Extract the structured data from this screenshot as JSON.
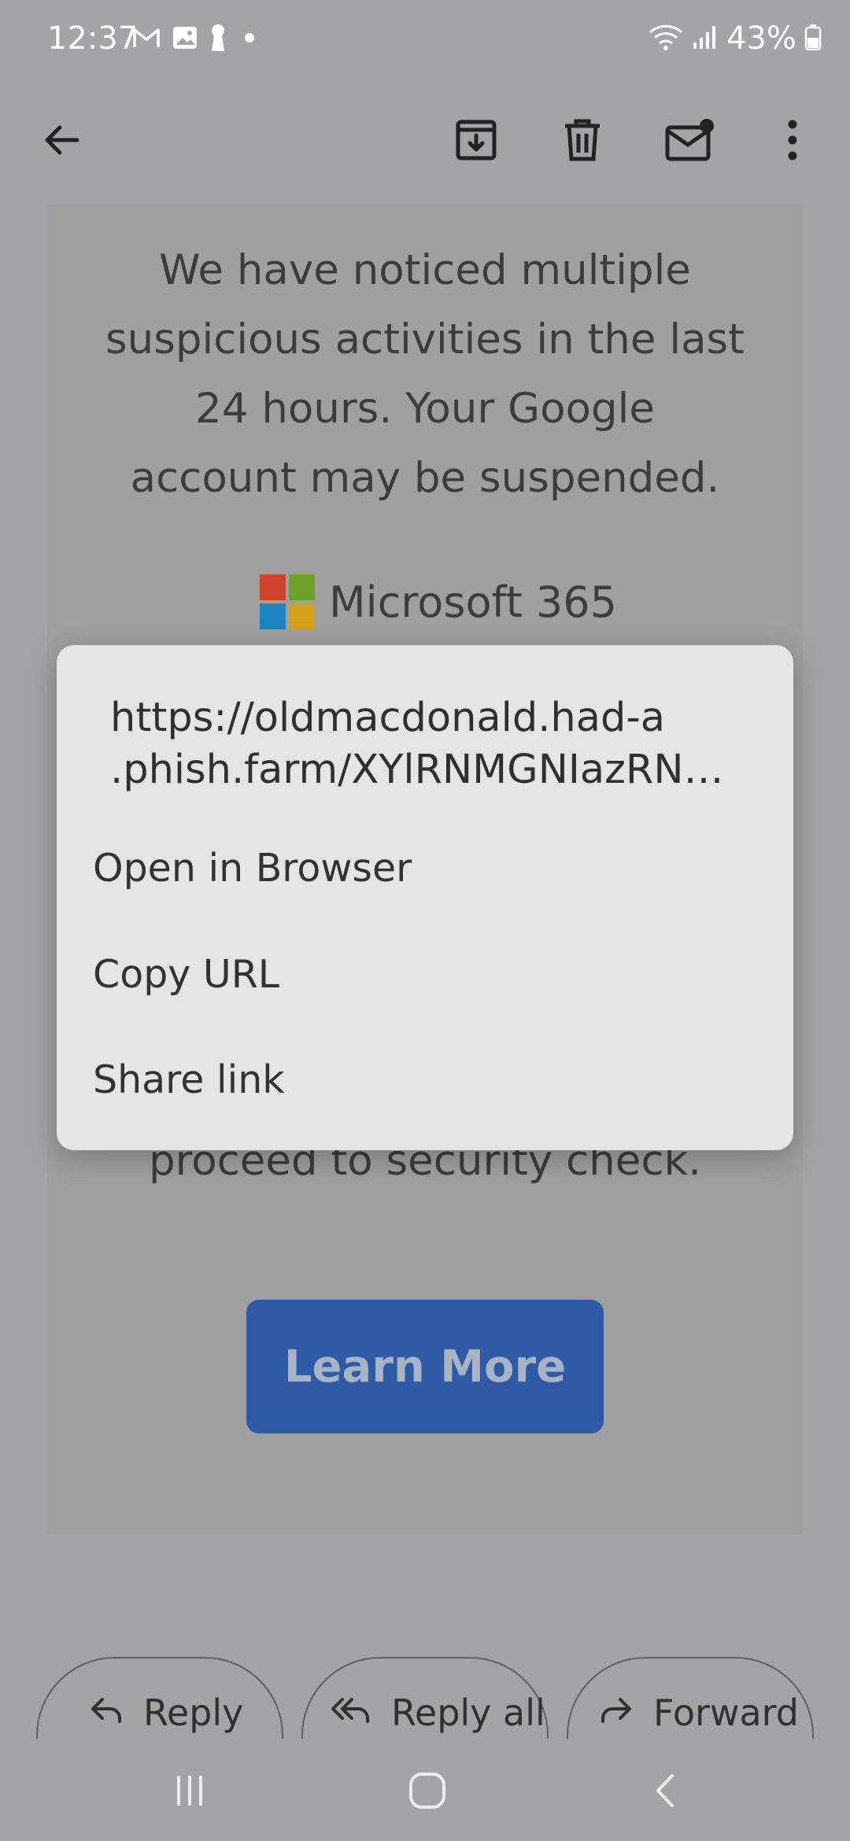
{
  "status_bar": {
    "time": "12:37",
    "battery_percent": "43%",
    "left_icons": [
      "gmail-icon",
      "gallery-icon",
      "keyhole-icon",
      "dot-icon"
    ],
    "right_icons": [
      "wifi-icon",
      "signal-icon",
      "battery-icon"
    ]
  },
  "app_bar": {
    "icons": [
      "back-arrow-icon",
      "archive-icon",
      "delete-icon",
      "mark-unread-icon",
      "more-vert-icon"
    ]
  },
  "email": {
    "body_lines": [
      "We have noticed multiple",
      "suspicious activities in the last",
      "24 hours. Your Google",
      "account may be suspended."
    ],
    "brand_name": "Microsoft 365",
    "brand_colors": [
      "#d0442b",
      "#6ca12a",
      "#1d85c2",
      "#d6a21a"
    ],
    "partial_text": "proceed to security check.",
    "cta_label": "Learn More",
    "cta_color": "#2f5aa6"
  },
  "link_menu": {
    "url_line1": "https://oldmacdonald.had-a",
    "url_line2": ".phish.farm/XYlRNMGNIazRN…",
    "items": [
      {
        "label": "Open in Browser"
      },
      {
        "label": "Copy URL"
      },
      {
        "label": "Share link"
      }
    ]
  },
  "actions": {
    "reply": "Reply",
    "reply_all": "Reply all",
    "forward": "Forward"
  },
  "nav_bar": {
    "icons": [
      "recents-icon",
      "home-icon",
      "back-icon"
    ]
  }
}
